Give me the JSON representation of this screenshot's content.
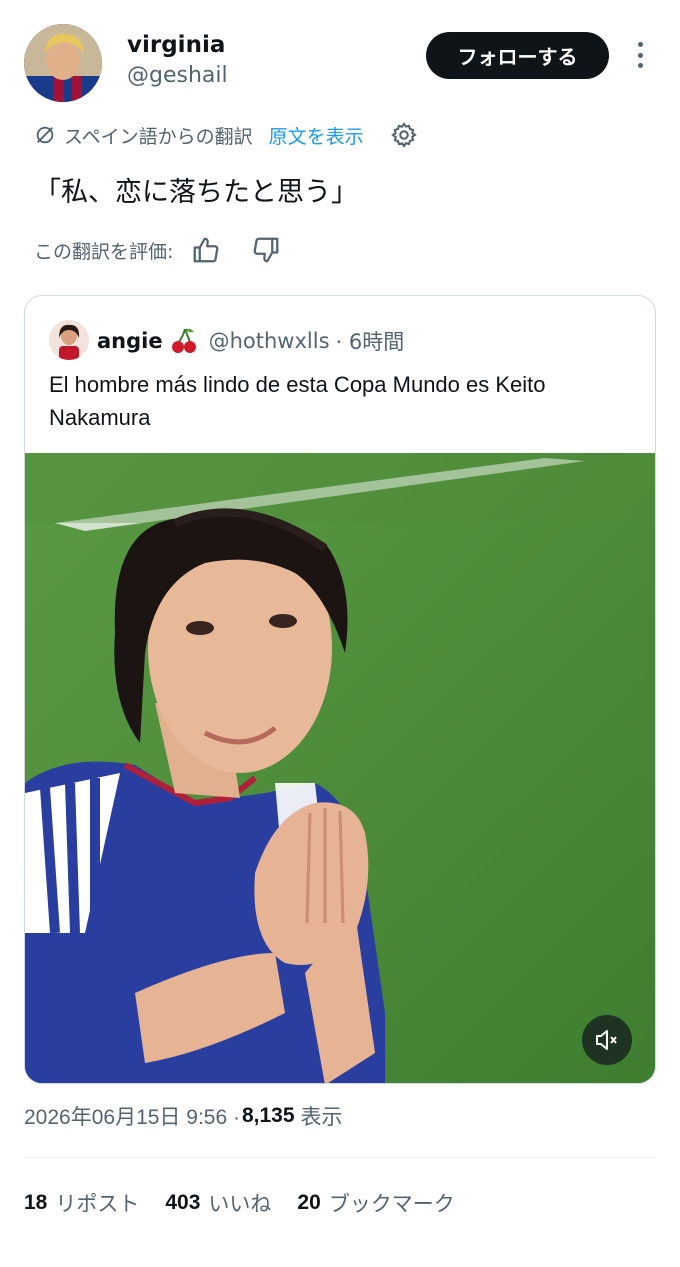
{
  "author": {
    "name": "virginia",
    "handle": "@geshail",
    "follow_label": "フォローする"
  },
  "translation": {
    "source_label": "スペイン語からの翻訳",
    "show_original_label": "原文を表示",
    "translated_text": "「私、恋に落ちたと思う」",
    "rate_label": "この翻訳を評価:"
  },
  "quoted_tweet": {
    "name": "angie",
    "handle": "@hothwxlls",
    "time": "· 6時間",
    "text": "El hombre más lindo de esta Copa Mundo es Keito Nakamura"
  },
  "meta": {
    "timestamp": "2026年06月15日 9:56 ·",
    "views_count": "8,135",
    "views_label": "表示"
  },
  "stats": {
    "reposts_count": "18",
    "reposts_label": "リポスト",
    "likes_count": "403",
    "likes_label": "いいね",
    "bookmarks_count": "20",
    "bookmarks_label": "ブックマーク"
  },
  "icons": {
    "translate": "translate-icon",
    "settings": "gear-icon",
    "rate_up": "thumbs-up-icon",
    "rate_down": "thumbs-down-icon",
    "more": "more-vertical-icon",
    "mute": "speaker-muted-icon",
    "emoji": "cherry-icon"
  },
  "colors": {
    "accent": "#1d9bf0",
    "text": "#0f1419",
    "secondary": "#536471",
    "button_bg": "#0f1419"
  }
}
